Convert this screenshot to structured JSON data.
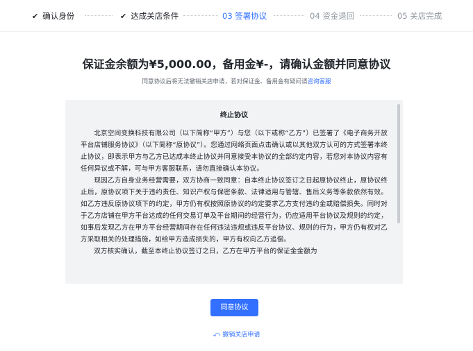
{
  "steps": [
    {
      "label": "确认身份",
      "status": "done",
      "mark": "✔"
    },
    {
      "label": "达成关店条件",
      "status": "done",
      "mark": "✔"
    },
    {
      "label": "03 签署协议",
      "status": "active"
    },
    {
      "label": "04 资金退回",
      "status": "pending"
    },
    {
      "label": "05 关店完成",
      "status": "pending"
    }
  ],
  "header": {
    "title": "保证金余额为¥5,000.00，备用金¥-，请确认金额并同意协议",
    "subtitle_prefix": "同意协议后将无法撤销关店申请，若对保证金、备用金有疑问请",
    "subtitle_link": "咨询客服"
  },
  "agreement": {
    "title": "终止协议",
    "paragraphs": [
      "北京空间变换科技有限公司（以下简称“甲方”）与您（以下或称“乙方”）已签署了《电子商务开放平台店铺服务协议》（以下简称“原协议”）。您通过网络页面点击确认或以其他双方认可的方式签署本终止协议，即表示甲方与乙方已达成本终止协议并同意接受本协议的全部约定内容，若您对本协议内容有任何异议或不解，可与甲方客服联系，请勿直接确认本协议。",
      "现因乙方自身业务经营需要，双方协商一致同意：自本终止协议签订之日起原协议终止，原协议终止后，原协议项下关于违约责任、知识产权与保密条款、法律适用与管辖、售后义务等条款依然有效。如乙方违反原协议项下的约定，甲方仍有权按照原协议的约定要求乙方支付违约金或赔偿损失。同时对于乙方店铺在甲方平台达成的任何交易订单及平台期间的经营行为，仍应适用平台协议及规则的约定，如事后发现乙方在甲方平台经营期间存在任何违法违规或违反平台协议、规则的行为，甲方仍有权对乙方采取相关的处理措施，如给甲方造成损失的，甲方有权向乙方追偿。",
      "双方核实确认，截至本终止协议签订之日，乙方在甲方平台的保证金金额为"
    ]
  },
  "actions": {
    "agree_label": "同意协议",
    "revoke_label": "撤销关店申请",
    "revoke_icon": "undo-icon"
  },
  "colors": {
    "accent": "#3370ff",
    "text": "#1f2329",
    "muted": "#8f959e",
    "panel": "#f2f3f5"
  }
}
